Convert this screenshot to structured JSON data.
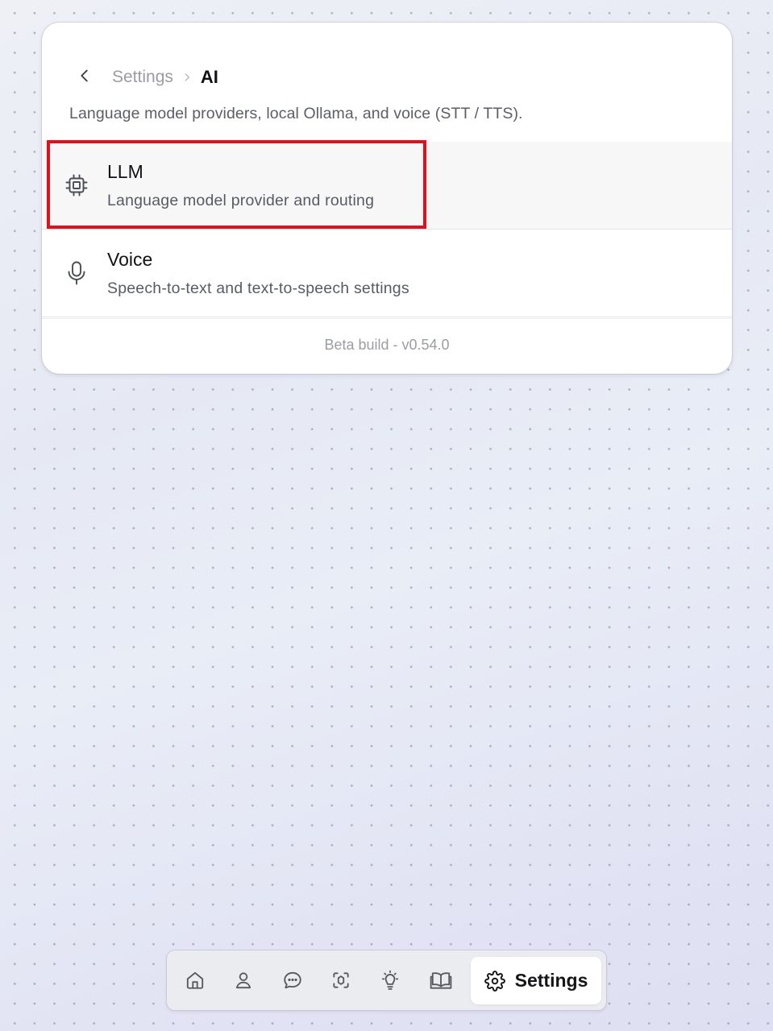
{
  "breadcrumb": {
    "parent": "Settings",
    "current": "AI"
  },
  "description": "Language model providers, local Ollama, and voice (STT / TTS).",
  "items": [
    {
      "title": "LLM",
      "subtitle": "Language model provider and routing",
      "icon": "cpu-chip-icon",
      "selected": true
    },
    {
      "title": "Voice",
      "subtitle": "Speech-to-text and text-to-speech settings",
      "icon": "microphone-icon",
      "selected": false
    }
  ],
  "footer": {
    "build": "Beta build - v0.54.0"
  },
  "nav": {
    "items": [
      {
        "icon": "home-icon"
      },
      {
        "icon": "person-icon"
      },
      {
        "icon": "chat-bubble-icon"
      },
      {
        "icon": "scan-focus-icon"
      },
      {
        "icon": "lightbulb-icon"
      },
      {
        "icon": "open-book-icon"
      }
    ],
    "active": {
      "icon": "gear-icon",
      "label": "Settings"
    }
  },
  "colors": {
    "highlight": "#e3101b",
    "text_primary": "#111216",
    "text_muted": "#9a9ca3"
  }
}
